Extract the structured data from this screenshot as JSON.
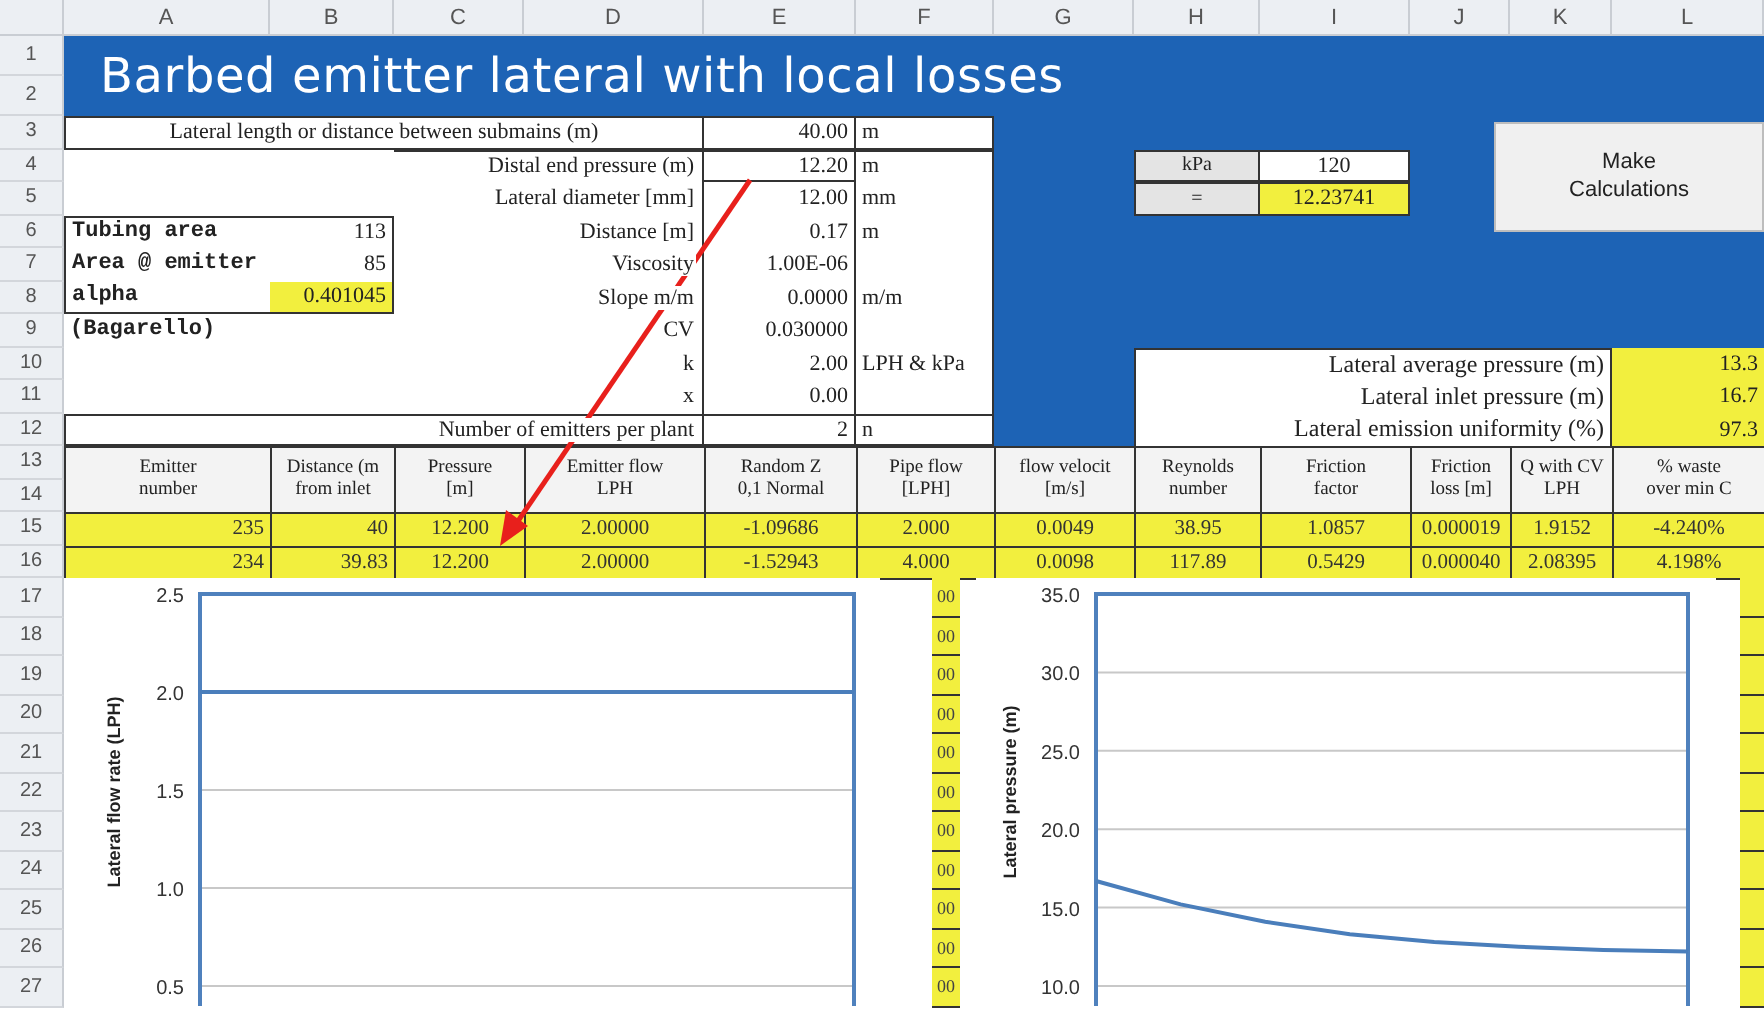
{
  "column_headers": [
    "A",
    "B",
    "C",
    "D",
    "E",
    "F",
    "G",
    "H",
    "I",
    "J",
    "K",
    "L"
  ],
  "row_numbers": [
    "1",
    "2",
    "3",
    "4",
    "5",
    "6",
    "7",
    "8",
    "9",
    "10",
    "11",
    "12",
    "13",
    "14",
    "15",
    "16",
    "17",
    "18",
    "19",
    "20",
    "21",
    "22",
    "23",
    "24",
    "25",
    "26",
    "27"
  ],
  "title": "Barbed emitter lateral with local losses",
  "inputs": [
    {
      "label": "Lateral length or distance between submains (m)",
      "value": "40.00",
      "unit": "m"
    },
    {
      "label": "Distal end pressure (m)",
      "value": "12.20",
      "unit": "m"
    },
    {
      "label": "Lateral diameter [mm]",
      "value": "12.00",
      "unit": "mm"
    },
    {
      "label": "Distance [m]",
      "value": "0.17",
      "unit": "m"
    },
    {
      "label": "Viscosity",
      "value": "1.00E-06"
    },
    {
      "label": "Slope m/m",
      "value": "0.0000",
      "unit": "m/m"
    },
    {
      "label": "CV",
      "value": "0.030000"
    },
    {
      "label": "k",
      "value": "2.00",
      "unit": "LPH & kPa"
    },
    {
      "label": "x",
      "value": "0.00"
    },
    {
      "label": "Number of emitters per plant",
      "value": "2",
      "unit": "n"
    }
  ],
  "tubing": [
    {
      "label": "Tubing area",
      "value": "113",
      "highlighted": false
    },
    {
      "label": "Area @ emitter",
      "value": "85",
      "highlighted": false
    },
    {
      "label": "alpha",
      "value": "0.401045",
      "highlighted": true
    }
  ],
  "tubing_note": "(Bagarello)",
  "converter": [
    {
      "label": "kPa",
      "value": "120",
      "highlighted": false
    },
    {
      "label": "=",
      "value": "12.23741",
      "highlighted": true
    }
  ],
  "button": "Make Calculations",
  "summary": [
    {
      "label": "Lateral average pressure (m)",
      "value": "13.3"
    },
    {
      "label": "Lateral inlet pressure (m)",
      "value": "16.7"
    },
    {
      "label": "Lateral emission uniformity (%)",
      "value": "97.3"
    }
  ],
  "table": {
    "columns": [
      "Emitter\nnumber",
      "Distance (m\nfrom inlet",
      "Pressure\n[m]",
      "Emitter flow\nLPH",
      "Random Z\n0,1 Normal",
      "Pipe flow\n[LPH]",
      "flow velocit\n[m/s]",
      "Reynolds\nnumber",
      "Friction\nfactor",
      "Friction\nloss [m]",
      "Q with CV\nLPH",
      "% waste\nover min C"
    ],
    "rows": [
      [
        "235",
        "40",
        "12.200",
        "2.00000",
        "-1.09686",
        "2.000",
        "0.0049",
        "38.95",
        "1.0857",
        "0.000019",
        "1.9152",
        "-4.240%"
      ],
      [
        "234",
        "39.83",
        "12.200",
        "2.00000",
        "-1.52943",
        "4.000",
        "0.0098",
        "117.89",
        "0.5429",
        "0.000040",
        "2.08395",
        "4.198%"
      ]
    ]
  },
  "hidden_cells": [
    "00",
    "00",
    "00",
    "00",
    "00",
    "00",
    "00",
    "00",
    "00",
    "00",
    "00"
  ],
  "charts": [
    {
      "chart_data": {
        "type": "line",
        "ylabel": "Lateral flow rate (LPH)",
        "ylim": [
          0.5,
          2.5
        ],
        "grid": true,
        "yticks": [
          {
            "value": 0.5,
            "label": "0.5"
          },
          {
            "value": 1,
            "label": "1.0"
          },
          {
            "value": 1.5,
            "label": "1.5"
          },
          {
            "value": 2,
            "label": "2.0"
          },
          {
            "value": 2.5,
            "label": "2.5"
          }
        ],
        "series": [
          {
            "color": "#4a7ebb",
            "values": [
              2.0,
              2.0,
              2.0,
              2.0,
              2.0,
              2.0,
              2.0,
              2.0
            ]
          }
        ]
      }
    },
    {
      "chart_data": {
        "type": "line",
        "ylabel": "Lateral pressure (m)",
        "ylim": [
          10,
          35
        ],
        "grid": true,
        "yticks": [
          {
            "value": 10,
            "label": "10.0"
          },
          {
            "value": 15,
            "label": "15.0"
          },
          {
            "value": 20,
            "label": "20.0"
          },
          {
            "value": 25,
            "label": "25.0"
          },
          {
            "value": 30,
            "label": "30.0"
          },
          {
            "value": 35,
            "label": "35.0"
          }
        ],
        "series": [
          {
            "color": "#4a7ebb",
            "values": [
              16.7,
              15.2,
              14.1,
              13.3,
              12.8,
              12.5,
              12.3,
              12.2
            ]
          }
        ]
      }
    }
  ]
}
